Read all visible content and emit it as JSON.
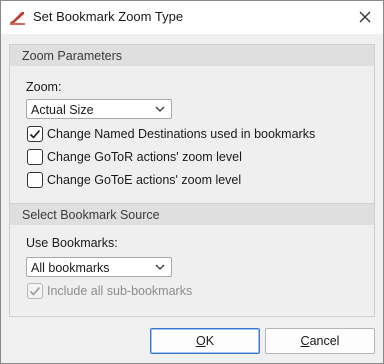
{
  "window": {
    "title": "Set Bookmark Zoom Type"
  },
  "zoom_group": {
    "title": "Zoom Parameters",
    "zoom_label": "Zoom:",
    "zoom_value": "Actual Size",
    "options": [
      {
        "label": "Change Named Destinations used in bookmarks",
        "checked": true
      },
      {
        "label": "Change GoToR actions' zoom level",
        "checked": false
      },
      {
        "label": "Change GoToE actions' zoom level",
        "checked": false
      }
    ]
  },
  "source_group": {
    "title": "Select Bookmark Source",
    "use_label": "Use Bookmarks:",
    "use_value": "All bookmarks",
    "sub_label": "Include all sub-bookmarks",
    "sub_checked": true,
    "sub_disabled": true
  },
  "buttons": {
    "ok_accel": "O",
    "ok_rest": "K",
    "cancel_accel": "C",
    "cancel_rest": "ancel"
  },
  "colors": {
    "accent": "#2a6fc9",
    "icon_red": "#c0392b"
  }
}
